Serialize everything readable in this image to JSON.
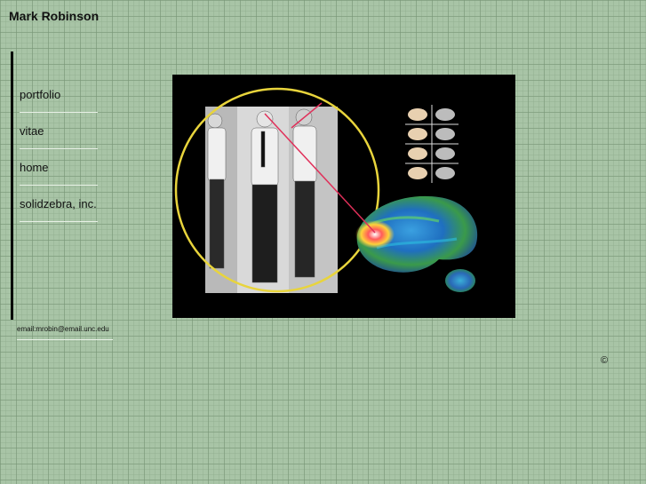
{
  "header": {
    "title": "Mark Robinson"
  },
  "nav": {
    "items": [
      {
        "label": "portfolio"
      },
      {
        "label": "vitae"
      },
      {
        "label": "home"
      },
      {
        "label": "solidzebra, inc."
      }
    ]
  },
  "contact": {
    "email": "email:mrobin@email.unc.edu"
  },
  "footer": {
    "copyright": "©"
  },
  "hero": {
    "icon": "composite-image-photo-brain-scan",
    "colors": {
      "background": "#000000",
      "circle": "#e8d43c",
      "line": "#e0305a"
    }
  }
}
